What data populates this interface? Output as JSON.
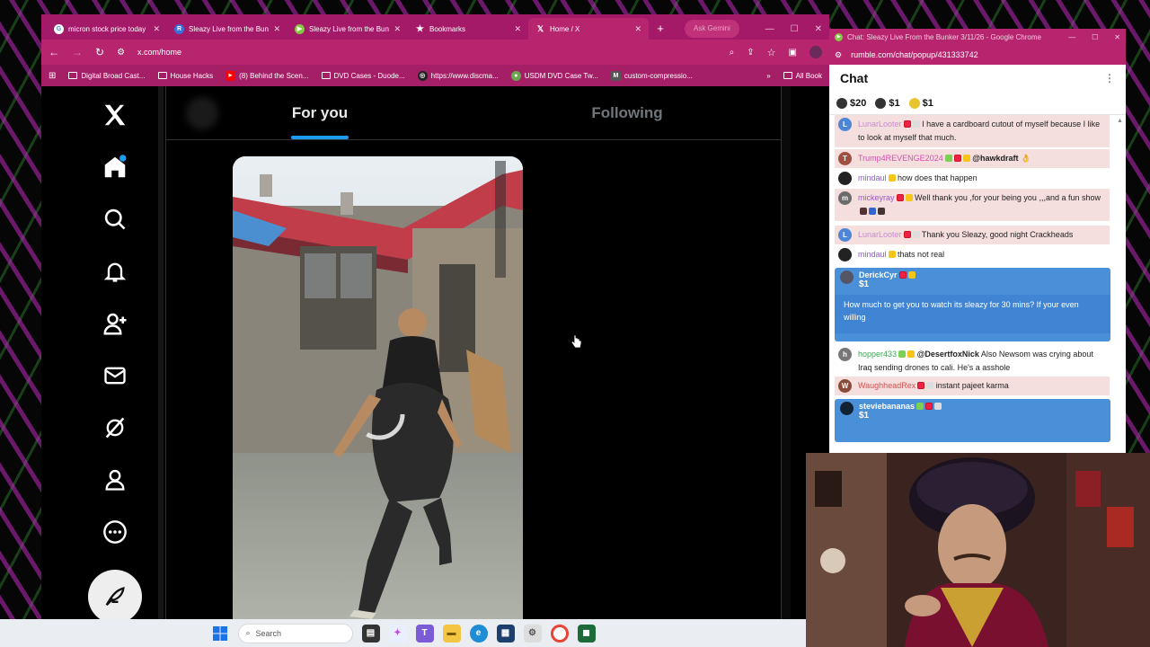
{
  "main_browser": {
    "tabs": [
      {
        "label": "micron stock price today",
        "favicon": "google-icon",
        "active": false
      },
      {
        "label": "Sleazy Live from the Bunk",
        "favicon": "r-icon",
        "active": false
      },
      {
        "label": "Sleazy Live from the Bun",
        "favicon": "rumble-icon",
        "active": false
      },
      {
        "label": "Bookmarks",
        "favicon": "star-icon",
        "active": false
      },
      {
        "label": "Home / X",
        "favicon": "x-icon",
        "active": true
      }
    ],
    "new_tab": "+",
    "ask_gemini": "Ask Gemini",
    "url": "x.com/home",
    "bookmarks": [
      {
        "label": "Digital Broad Cast...",
        "icon": "folder-icon"
      },
      {
        "label": "House Hacks",
        "icon": "folder-icon"
      },
      {
        "label": "(8) Behind the Scen...",
        "icon": "youtube-icon"
      },
      {
        "label": "DVD Cases - Duode...",
        "icon": "folder-icon"
      },
      {
        "label": "https://www.discma...",
        "icon": "globe-icon"
      },
      {
        "label": "USDM DVD Case Tw...",
        "icon": "globe-icon"
      },
      {
        "label": "custom-compressio...",
        "icon": "globe-icon"
      }
    ],
    "bookmarks_more": "»",
    "all_bookmarks": "All Book"
  },
  "x_app": {
    "tabs": [
      {
        "label": "For you",
        "active": true
      },
      {
        "label": "Following",
        "active": false
      }
    ]
  },
  "chat_window": {
    "title": "Chat: Sleazy Live From the Bunker 3/11/26 - Google Chrome",
    "url": "rumble.com/chat/popup/431333742",
    "header": "Chat",
    "rants": [
      {
        "amount": "$20"
      },
      {
        "amount": "$1"
      },
      {
        "amount": "$1"
      }
    ],
    "messages": [
      {
        "user": "LunarLooter",
        "user_color": "#c98bd0",
        "avatar": "L",
        "avatar_color": "#4d86d6",
        "text": "I have a cardboard cutout of myself because I like to look at myself that much.",
        "highlight": true
      },
      {
        "user": "Trump4REVENGE2024",
        "user_color": "#d44fb0",
        "avatar": "T",
        "avatar_color": "#a05040",
        "mention": "@hawkdraft",
        "text": "👌",
        "highlight": false
      },
      {
        "user": "mindaul",
        "user_color": "#8a5cc7",
        "avatar": "",
        "avatar_color": "#222",
        "text": "how does that happen",
        "highlight": false
      },
      {
        "user": "mickeyray",
        "user_color": "#9b59c9",
        "avatar": "m",
        "avatar_color": "#6b6b6b",
        "text": "Well thank you ,for your being you ,,,and a fun show",
        "highlight": true
      },
      {
        "user": "LunarLooter",
        "user_color": "#c98bd0",
        "avatar": "L",
        "avatar_color": "#4d86d6",
        "text": "Thank you Sleazy, good night Crackheads",
        "highlight": true
      },
      {
        "user": "mindaul",
        "user_color": "#8a5cc7",
        "avatar": "",
        "avatar_color": "#222",
        "text": "thats not real",
        "highlight": false
      },
      {
        "user": "hopper433",
        "user_color": "#3aa655",
        "avatar": "h",
        "avatar_color": "#777",
        "mention": "@DesertfoxNick",
        "text": "Also Newsom was crying about Iraq sending drones to cali. He's a asshole",
        "highlight": false
      },
      {
        "user": "WaughheadRex",
        "user_color": "#d05050",
        "avatar": "W",
        "avatar_color": "#8a4a3a",
        "text": "instant pajeet karma",
        "highlight": true
      }
    ],
    "rant_messages": [
      {
        "user": "DerickCyr",
        "amount": "$1",
        "text": "How much to get you to watch its sleazy for 30 mins? If your even willing"
      },
      {
        "user": "steviebananas",
        "amount": "$1",
        "text": ""
      }
    ]
  },
  "taskbar": {
    "search_placeholder": "Search"
  }
}
